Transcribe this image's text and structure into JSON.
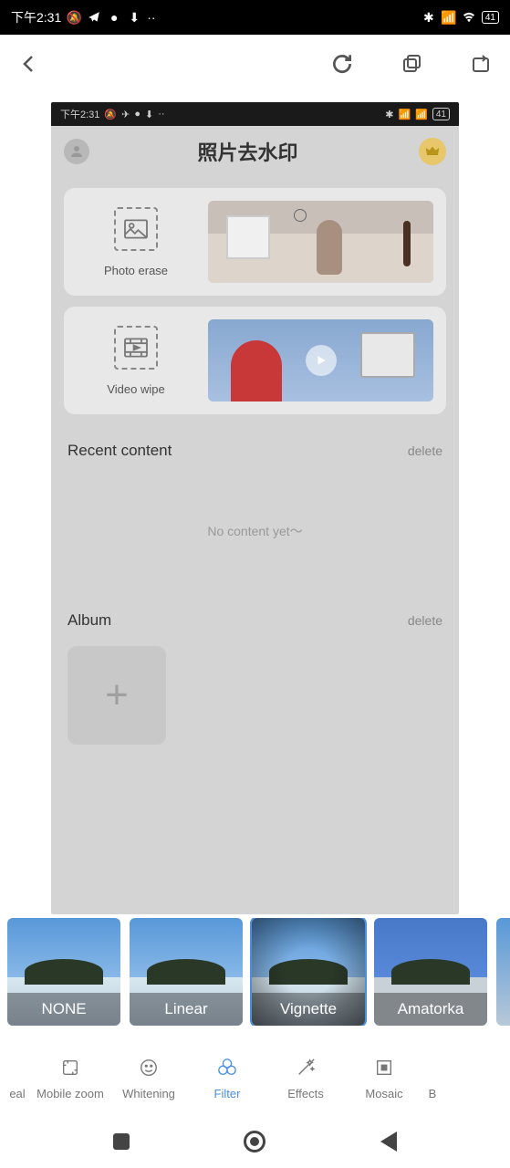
{
  "outer_status": {
    "time": "下午2:31",
    "battery": "41"
  },
  "top_toolbar": {},
  "inner_screenshot": {
    "status": {
      "time": "下午2:31",
      "battery": "41"
    },
    "title": "照片去水印",
    "card_photo": {
      "label": "Photo erase"
    },
    "card_video": {
      "label": "Video wipe"
    },
    "recent": {
      "title": "Recent content",
      "action": "delete",
      "empty": "No content yet〜"
    },
    "album": {
      "title": "Album",
      "action": "delete"
    }
  },
  "filters": [
    {
      "name": "NONE",
      "selected": false,
      "variant": "f-none"
    },
    {
      "name": "Linear",
      "selected": false,
      "variant": "f-linear"
    },
    {
      "name": "Vignette",
      "selected": true,
      "variant": "f-vignette"
    },
    {
      "name": "Amatorka",
      "selected": false,
      "variant": "f-amatorka"
    }
  ],
  "tools": {
    "partial_left": "eal",
    "items": [
      {
        "label": "Mobile zoom",
        "active": false
      },
      {
        "label": "Whitening",
        "active": false
      },
      {
        "label": "Filter",
        "active": true
      },
      {
        "label": "Effects",
        "active": false
      },
      {
        "label": "Mosaic",
        "active": false
      }
    ],
    "partial_right": "B"
  }
}
